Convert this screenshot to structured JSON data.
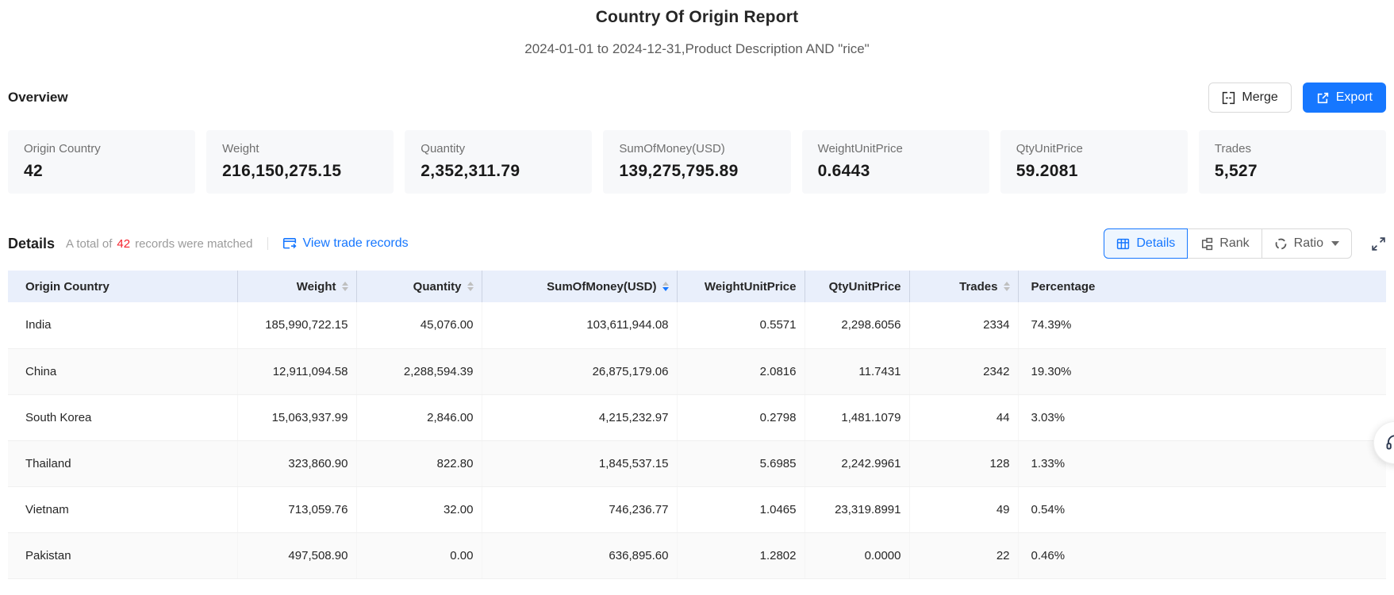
{
  "report": {
    "title": "Country Of Origin Report",
    "subtitle": "2024-01-01 to 2024-12-31,Product Description AND \"rice\""
  },
  "colors": {
    "accent": "#1677ff",
    "matched_count_red": "#f5222d",
    "table_header_bg": "#e9effb",
    "card_bg": "#f7f8fa"
  },
  "overview": {
    "heading": "Overview",
    "merge_label": "Merge",
    "export_label": "Export",
    "cards": [
      {
        "label": "Origin Country",
        "value": "42"
      },
      {
        "label": "Weight",
        "value": "216,150,275.15"
      },
      {
        "label": "Quantity",
        "value": "2,352,311.79"
      },
      {
        "label": "SumOfMoney(USD)",
        "value": "139,275,795.89"
      },
      {
        "label": "WeightUnitPrice",
        "value": "0.6443"
      },
      {
        "label": "QtyUnitPrice",
        "value": "59.2081"
      },
      {
        "label": "Trades",
        "value": "5,527"
      }
    ]
  },
  "details": {
    "heading": "Details",
    "matched_prefix": "A total of",
    "matched_count": "42",
    "matched_suffix": "records were matched",
    "view_trade_records": "View trade records",
    "tabs": [
      {
        "label": "Details",
        "icon": "table-icon",
        "active": true,
        "caret": false
      },
      {
        "label": "Rank",
        "icon": "rank-icon",
        "active": false,
        "caret": false
      },
      {
        "label": "Ratio",
        "icon": "ratio-icon",
        "active": false,
        "caret": true
      }
    ]
  },
  "table": {
    "columns": [
      {
        "label": "Origin Country",
        "sortable": false,
        "align": "left",
        "sort": "none"
      },
      {
        "label": "Weight",
        "sortable": true,
        "align": "right",
        "sort": "none"
      },
      {
        "label": "Quantity",
        "sortable": true,
        "align": "right",
        "sort": "none"
      },
      {
        "label": "SumOfMoney(USD)",
        "sortable": true,
        "align": "right",
        "sort": "desc"
      },
      {
        "label": "WeightUnitPrice",
        "sortable": false,
        "align": "right",
        "sort": "none"
      },
      {
        "label": "QtyUnitPrice",
        "sortable": false,
        "align": "right",
        "sort": "none"
      },
      {
        "label": "Trades",
        "sortable": true,
        "align": "right",
        "sort": "none"
      },
      {
        "label": "Percentage",
        "sortable": false,
        "align": "left",
        "sort": "none"
      }
    ],
    "rows": [
      [
        "India",
        "185,990,722.15",
        "45,076.00",
        "103,611,944.08",
        "0.5571",
        "2,298.6056",
        "2334",
        "74.39%"
      ],
      [
        "China",
        "12,911,094.58",
        "2,288,594.39",
        "26,875,179.06",
        "2.0816",
        "11.7431",
        "2342",
        "19.30%"
      ],
      [
        "South Korea",
        "15,063,937.99",
        "2,846.00",
        "4,215,232.97",
        "0.2798",
        "1,481.1079",
        "44",
        "3.03%"
      ],
      [
        "Thailand",
        "323,860.90",
        "822.80",
        "1,845,537.15",
        "5.6985",
        "2,242.9961",
        "128",
        "1.33%"
      ],
      [
        "Vietnam",
        "713,059.76",
        "32.00",
        "746,236.77",
        "1.0465",
        "23,319.8991",
        "49",
        "0.54%"
      ],
      [
        "Pakistan",
        "497,508.90",
        "0.00",
        "636,895.60",
        "1.2802",
        "0.0000",
        "22",
        "0.46%"
      ]
    ]
  },
  "floating": {
    "support_icon": "headset-icon"
  }
}
